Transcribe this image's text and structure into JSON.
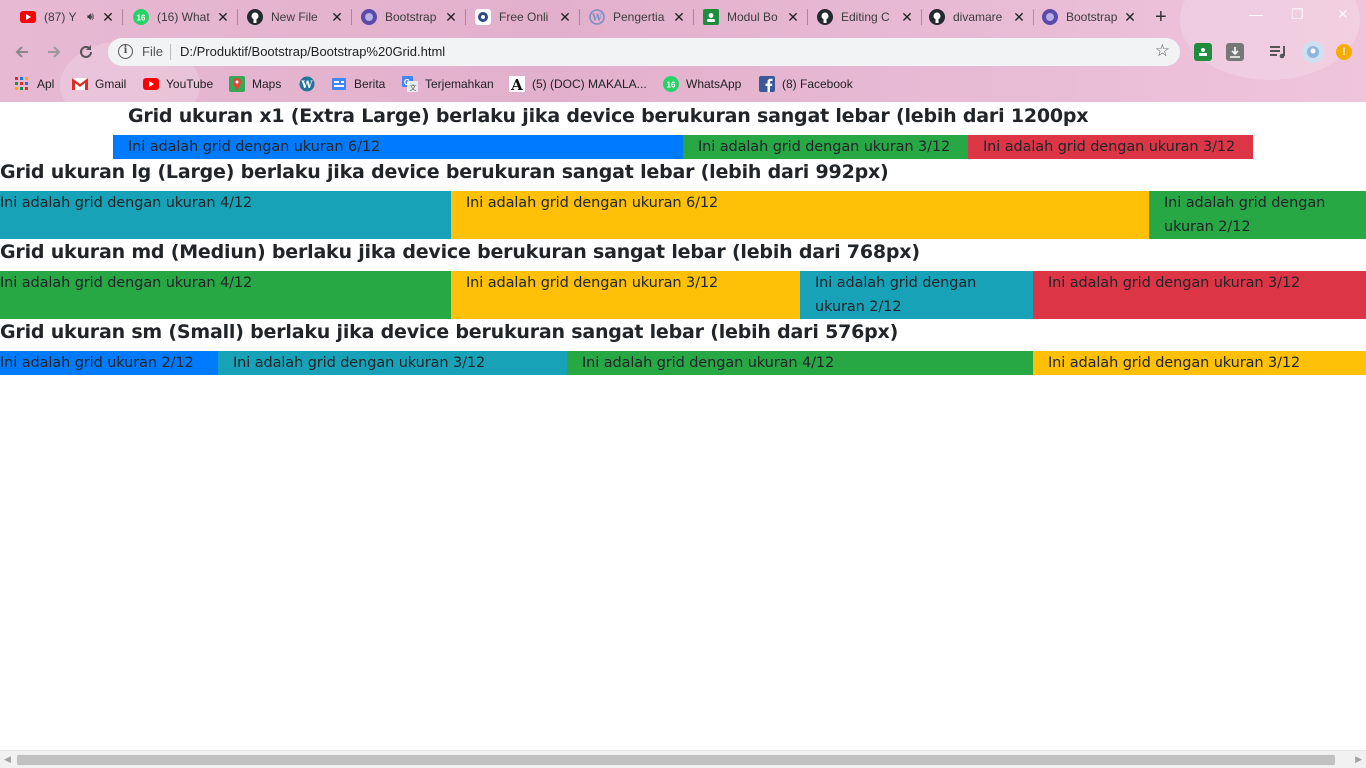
{
  "browser": {
    "tabs": [
      {
        "title": "(87) Y",
        "icon": "youtube-icon"
      },
      {
        "title": "(16) What",
        "icon": "whatsapp-icon"
      },
      {
        "title": "New File",
        "icon": "github-icon"
      },
      {
        "title": "Bootstrap",
        "icon": "bootstrap-icon"
      },
      {
        "title": "Free Onli",
        "icon": "site-icon"
      },
      {
        "title": "Pengertia",
        "icon": "wordpress-icon"
      },
      {
        "title": "Modul Bo",
        "icon": "classroom-icon"
      },
      {
        "title": "Editing C",
        "icon": "github-icon"
      },
      {
        "title": "divamare",
        "icon": "github-icon"
      },
      {
        "title": "Bootstrap",
        "icon": "bootstrap-icon"
      }
    ],
    "address": {
      "scheme_label": "File",
      "url": "D:/Produktif/Bootstrap/Bootstrap%20Grid.html"
    },
    "bookmarks": [
      {
        "label": "Apl",
        "icon": "apps-icon"
      },
      {
        "label": "Gmail",
        "icon": "gmail-icon"
      },
      {
        "label": "YouTube",
        "icon": "youtube-icon"
      },
      {
        "label": "Maps",
        "icon": "maps-icon"
      },
      {
        "label": "",
        "icon": "wordpress-icon"
      },
      {
        "label": "Berita",
        "icon": "news-icon"
      },
      {
        "label": "Terjemahkan",
        "icon": "translate-icon"
      },
      {
        "label": "(5) (DOC) MAKALA...",
        "icon": "academia-icon"
      },
      {
        "label": "WhatsApp",
        "icon": "whatsapp-icon"
      },
      {
        "label": "(8) Facebook",
        "icon": "facebook-icon"
      }
    ],
    "colors": {
      "chrome_background": "#e5b6d1",
      "primary": "#007bff",
      "success": "#28a745",
      "danger": "#dc3545",
      "info": "#17a2b8",
      "warning": "#ffc107"
    }
  },
  "page": {
    "sections": [
      {
        "heading": "Grid ukuran x1 (Extra Large) berlaku jika device berukuran sangat lebar (lebih dari 1200px",
        "cells": [
          {
            "text": "Ini adalah grid dengan ukuran 6/12",
            "color": "primary"
          },
          {
            "text": "Ini adalah grid dengan ukuran 3/12",
            "color": "success"
          },
          {
            "text": "Ini adalah grid dengan ukuran 3/12",
            "color": "danger"
          }
        ]
      },
      {
        "heading": "Grid ukuran lg (Large) berlaku jika device berukuran sangat lebar (lebih dari 992px)",
        "cells": [
          {
            "text": "Ini adalah grid dengan ukuran 4/12",
            "color": "info"
          },
          {
            "text": "Ini adalah grid dengan ukuran 6/12",
            "color": "warning"
          },
          {
            "text": "Ini adalah grid dengan ukuran 2/12",
            "color": "success"
          }
        ]
      },
      {
        "heading": "Grid ukuran md (Mediun) berlaku jika device berukuran sangat lebar (lebih dari 768px)",
        "cells": [
          {
            "text": "Ini adalah grid dengan ukuran 4/12",
            "color": "success"
          },
          {
            "text": "Ini adalah grid dengan ukuran 3/12",
            "color": "warning"
          },
          {
            "text": "Ini adalah grid dengan ukuran 2/12",
            "color": "info"
          },
          {
            "text": "Ini adalah grid dengan ukuran 3/12",
            "color": "danger"
          }
        ]
      },
      {
        "heading": "Grid ukuran sm (Small) berlaku jika device berukuran sangat lebar (lebih dari 576px)",
        "cells": [
          {
            "text": "Ini adalah grid ukuran 2/12",
            "color": "primary"
          },
          {
            "text": "Ini adalah grid dengan ukuran 3/12",
            "color": "info"
          },
          {
            "text": "Ini adalah grid dengan ukuran 4/12",
            "color": "success"
          },
          {
            "text": "Ini adalah grid dengan ukuran 3/12",
            "color": "warning"
          }
        ]
      }
    ]
  }
}
